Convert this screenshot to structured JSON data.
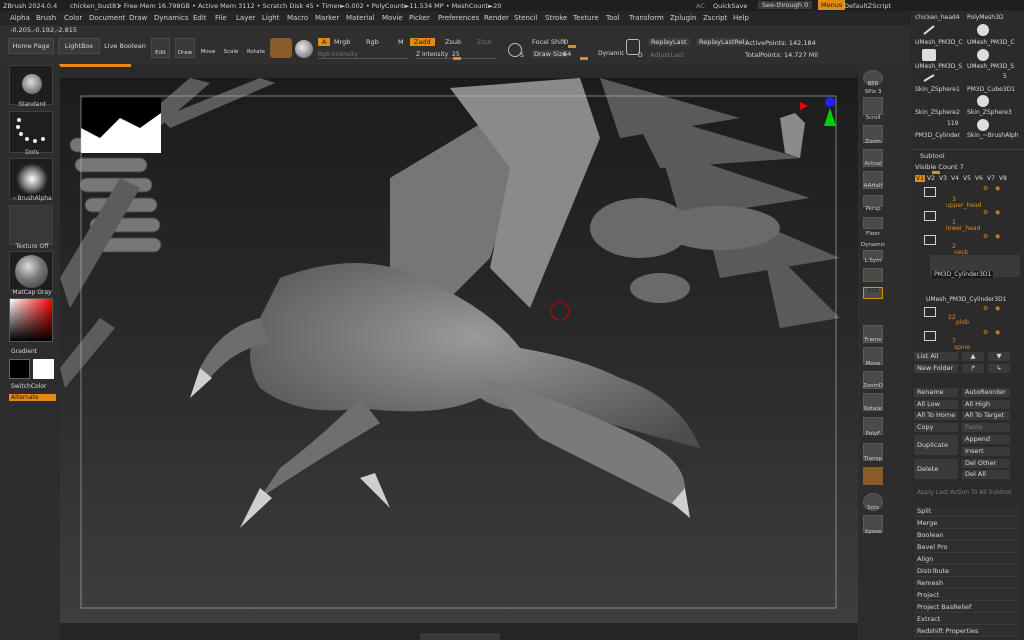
{
  "title_bar": {
    "app": "ZBrush 2024.0.4",
    "document": "chicken_bust81",
    "stats": "• Free Mem 16.798GB • Active Mem 3112 • Scratch Disk 45 • Timer►0.002 • PolyCount►11.534 MP • MeshCount►20",
    "ac": "AC",
    "quicksave": "QuickSave",
    "see_through": "See-through  0",
    "menus": "Menus",
    "script": "DefaultZScript"
  },
  "menu": [
    "Alpha",
    "Brush",
    "Color",
    "Document",
    "Draw",
    "Dynamics",
    "Edit",
    "File",
    "Layer",
    "Light",
    "Macro",
    "Marker",
    "Material",
    "Movie",
    "Picker",
    "Preferences",
    "Render",
    "Stencil",
    "Stroke",
    "Texture",
    "Tool",
    "Transform",
    "Zplugin",
    "Zscript",
    "Help"
  ],
  "toolbar": {
    "coords": "-0.205,-0.192,-2.815",
    "home_page": "Home Page",
    "lightbox": "LightBox",
    "live_boolean": "Live Boolean",
    "edit": "Edit",
    "draw": "Draw",
    "move": "Move",
    "scale": "Scale",
    "rotate": "Rotate",
    "a": "A",
    "mrgb": "Mrgb",
    "rgb": "Rgb",
    "m": "M",
    "zadd": "Zadd",
    "zsub": "Zsub",
    "zcut": "Zcut",
    "rgb_intensity": "Rgb Intensity",
    "z_intensity": "Z Intensity",
    "z_intensity_value": "25",
    "focal_shift": "Focal Shift",
    "focal_shift_value": "0",
    "draw_size": "Draw Size",
    "draw_size_value": "64",
    "dynamic": "Dynamic",
    "replay_last": "ReplayLast",
    "replay_last_rel": "ReplayLastRel",
    "adjust_last": "AdjustLast",
    "active_points": "ActivePoints: 142,184",
    "total_points": "TotalPoints: 14.727 Mil",
    "s_label": "S",
    "d_label": "D"
  },
  "left_shelf": {
    "brush": "Standard",
    "stroke": "Dots",
    "alpha": "~BrushAlpha",
    "texture": "Texture Off",
    "material": "MatCap Gray",
    "gradient": "Gradient",
    "switch_color": "SwitchColor",
    "alternate": "Alternate"
  },
  "right_shelf": [
    "BPR",
    "SPix 3",
    "Scroll",
    "Zoom",
    "Actual",
    "AAHalf",
    "Persp",
    "Floor",
    "Dynamic",
    "L.Sym",
    "",
    "XYZ",
    "",
    "Frame",
    "Move",
    "ZoomD",
    "Rotate",
    "PolyF",
    "Transp",
    "",
    "Solo",
    "Xpose"
  ],
  "tool_panel": {
    "tools": [
      "chicken_head4",
      "PolyMesh3D",
      "UMesh_PM3D_C",
      "UMesh_PM3D_C",
      "UMesh_PM3D_S",
      "UMesh_PM3D_S",
      "Skin_ZSphere1",
      "PM3D_Cube3D1",
      "Skin_ZSphere2",
      "Skin_ZSphere3",
      "PM3D_Cylinder",
      "Skin_~BrushAlph"
    ],
    "tool_numbers": [
      "5",
      "119"
    ],
    "subtool_title": "Subtool",
    "visible_count": "Visible Count  7",
    "v_tabs": [
      "V1",
      "V2",
      "V3",
      "V4",
      "V5",
      "V6",
      "V7",
      "V8"
    ],
    "subtools": [
      {
        "name": "upper_head",
        "count": "3"
      },
      {
        "name": "lower_head",
        "count": "1"
      },
      {
        "name": "neck",
        "count": "2"
      },
      {
        "name": "PM3D_Cylinder3D1",
        "count": ""
      },
      {
        "name": "UMesh_PM3D_Cylinder3D1",
        "count": ""
      },
      {
        "name": "plob",
        "count": "22"
      },
      {
        "name": "spine",
        "count": "7"
      }
    ],
    "list_all": "List All",
    "new_folder": "New Folder",
    "rename": "Rename",
    "auto_reorder": "AutoReorder",
    "all_low": "All Low",
    "all_high": "All High",
    "all_to_home": "All To Home",
    "all_to_target": "All To Target",
    "copy": "Copy",
    "paste": "Paste",
    "duplicate": "Duplicate",
    "append": "Append",
    "insert": "Insert",
    "delete": "Delete",
    "del_other": "Del Other",
    "del_all": "Del All",
    "apply_last": "Apply Last Action To All Subtool",
    "sections": [
      "Split",
      "Merge",
      "Boolean",
      "Bevel Pro",
      "Align",
      "Distribute",
      "Remesh",
      "Project",
      "Project BasRelief",
      "Extract",
      "Redshift Properties"
    ]
  },
  "colors": {
    "accent": "#e28a1a",
    "bg": "#2a2a2a",
    "canvas": "#3a3a3a"
  }
}
